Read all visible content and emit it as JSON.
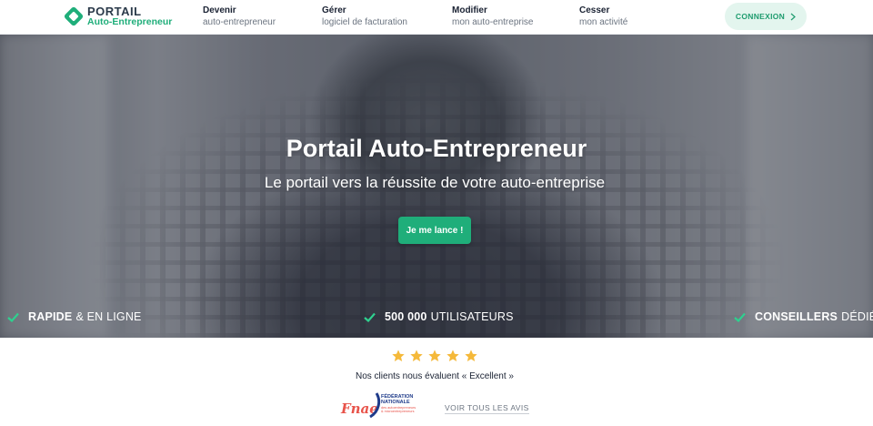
{
  "header": {
    "logo": {
      "line1": "PORTAIL",
      "line2": "Auto-Entrepreneur"
    },
    "nav": [
      {
        "title": "Devenir",
        "sub": "auto-entrepreneur"
      },
      {
        "title": "Gérer",
        "sub": "logiciel de facturation"
      },
      {
        "title": "Modifier",
        "sub": "mon auto-entreprise"
      },
      {
        "title": "Cesser",
        "sub": "mon activité"
      }
    ],
    "login_label": "CONNEXION"
  },
  "hero": {
    "title": "Portail Auto-Entrepreneur",
    "subtitle": "Le portail vers la réussite de votre auto-entreprise",
    "cta_label": "Je me lance !",
    "features": [
      {
        "bold": "RAPIDE",
        "rest": "& EN LIGNE"
      },
      {
        "bold": "500 000",
        "rest": "UTILISATEURS"
      },
      {
        "bold": "CONSEILLERS",
        "rest": "DÉDIÉS"
      }
    ]
  },
  "reviews": {
    "stars": 5,
    "rating_text": "Nos clients nous évaluent « Excellent »",
    "partner_logo": {
      "name": "Fnae",
      "line1": "FÉDÉRATION",
      "line2": "NATIONALE",
      "line3": "des autoentrepreneurs",
      "line4": "& microentrepreneurs"
    },
    "see_all_label": "VOIR TOUS LES AVIS"
  },
  "colors": {
    "accent": "#1fae7a",
    "accent_light": "#e3f5ee",
    "star": "#f5b93a",
    "fnae_red": "#e8534a",
    "fnae_blue": "#1f3b8a"
  }
}
